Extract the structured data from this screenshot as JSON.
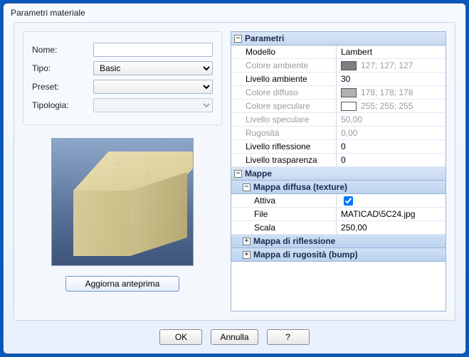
{
  "window": {
    "title": "Parametri materiale"
  },
  "form": {
    "name_label": "Nome:",
    "name_value": "",
    "type_label": "Tipo:",
    "type_value": "Basic",
    "preset_label": "Preset:",
    "preset_value": "",
    "typology_label": "Tipologia:",
    "typology_value": ""
  },
  "preview": {
    "update_label": "Aggiorna anteprima"
  },
  "propgrid": {
    "parametri_header": "Parametri",
    "rows": [
      {
        "key": "Modello",
        "value": "Lambert",
        "disabled": false
      },
      {
        "key": "Colore ambiente",
        "swatch": "#7f7f7f",
        "value": "127; 127; 127",
        "disabled": true
      },
      {
        "key": "Livello ambiente",
        "value": "30",
        "disabled": false
      },
      {
        "key": "Colore diffuso",
        "swatch": "#b2b2b2",
        "value": "178; 178; 178",
        "disabled": true
      },
      {
        "key": "Colore speculare",
        "swatch": "#ffffff",
        "value": "255; 255; 255",
        "disabled": true
      },
      {
        "key": "Livello speculare",
        "value": "50,00",
        "disabled": true
      },
      {
        "key": "Rugosità",
        "value": "0,00",
        "disabled": true
      },
      {
        "key": "Livello riflessione",
        "value": "0",
        "disabled": false
      },
      {
        "key": "Livello trasparenza",
        "value": "0",
        "disabled": false
      }
    ],
    "mappe_header": "Mappe",
    "mappa_diffusa_header": "Mappa diffusa (texture)",
    "diffusa_rows": {
      "attiva_key": "Attiva",
      "attiva_checked": true,
      "file_key": "File",
      "file_value": "MATICAD\\5C24.jpg",
      "scala_key": "Scala",
      "scala_value": "250,00"
    },
    "mappa_riflessione_header": "Mappa di riflessione",
    "mappa_rugosita_header": "Mappa di rugosità (bump)"
  },
  "buttons": {
    "ok": "OK",
    "cancel": "Annulla",
    "help": "?"
  }
}
